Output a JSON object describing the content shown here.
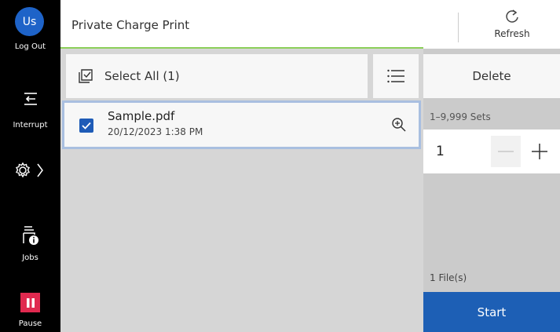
{
  "rail": {
    "avatar_initials": "Us",
    "logout_label": "Log Out",
    "interrupt_label": "Interrupt",
    "jobs_label": "Jobs",
    "pause_label": "Pause",
    "settings_icon": "gear-icon",
    "pause_color": "#e0294f"
  },
  "header": {
    "title": "Private Charge Print",
    "refresh_label": "Refresh"
  },
  "list": {
    "select_all_label": "Select All (1)",
    "files": [
      {
        "name": "Sample.pdf",
        "date": "20/12/2023 1:38 PM",
        "checked": true
      }
    ]
  },
  "panel": {
    "delete_label": "Delete",
    "range_label": "1–9,999 Sets",
    "quantity": "1",
    "files_count": "1 File(s)",
    "start_label": "Start",
    "start_color": "#1d5fb5"
  }
}
